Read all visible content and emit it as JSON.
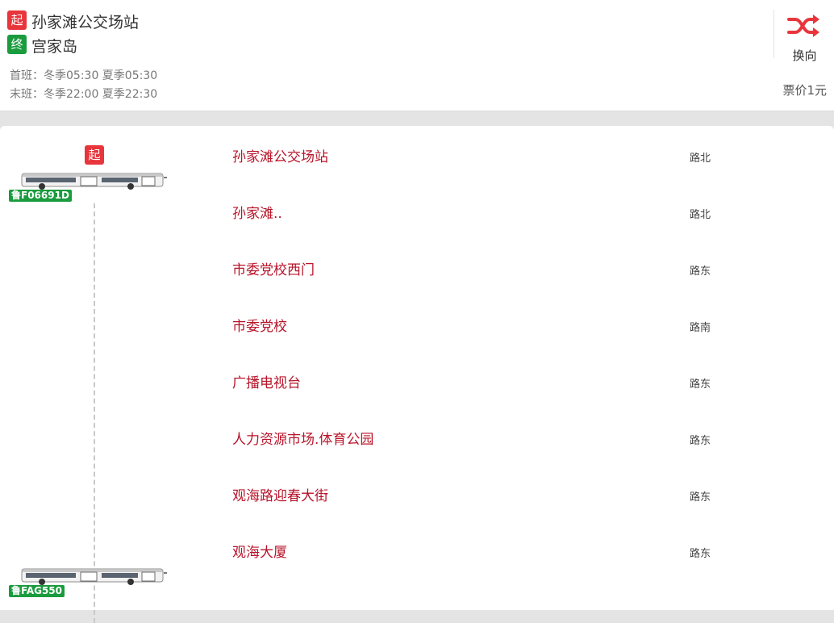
{
  "route": {
    "start_badge": "起",
    "end_badge": "终",
    "start_stop": "孙家滩公交场站",
    "end_stop": "宫家岛",
    "first_bus": "首班：冬季05:30 夏季05:30",
    "last_bus": "末班：冬季22:00 夏季22:30",
    "switch_label": "换向",
    "fare": "票价1元"
  },
  "colors": {
    "start": "#e8353c",
    "end": "#1a9b3e",
    "station_name": "#b8142a",
    "switch_icon": "#e8353c"
  },
  "timeline": {
    "start_marker": "起",
    "buses": [
      {
        "plate": "鲁F06691D",
        "icon": "bus-icon"
      },
      {
        "plate": "鲁FAG550",
        "icon": "bus-icon"
      }
    ]
  },
  "stations": [
    {
      "name": "孙家滩公交场站",
      "direction": "路北"
    },
    {
      "name": "孙家滩..",
      "direction": "路北"
    },
    {
      "name": "市委党校西门",
      "direction": "路东"
    },
    {
      "name": "市委党校",
      "direction": "路南"
    },
    {
      "name": "广播电视台",
      "direction": "路东"
    },
    {
      "name": "人力资源市场.体育公园",
      "direction": "路东"
    },
    {
      "name": "观海路迎春大街",
      "direction": "路东"
    },
    {
      "name": "观海大厦",
      "direction": "路东"
    }
  ]
}
